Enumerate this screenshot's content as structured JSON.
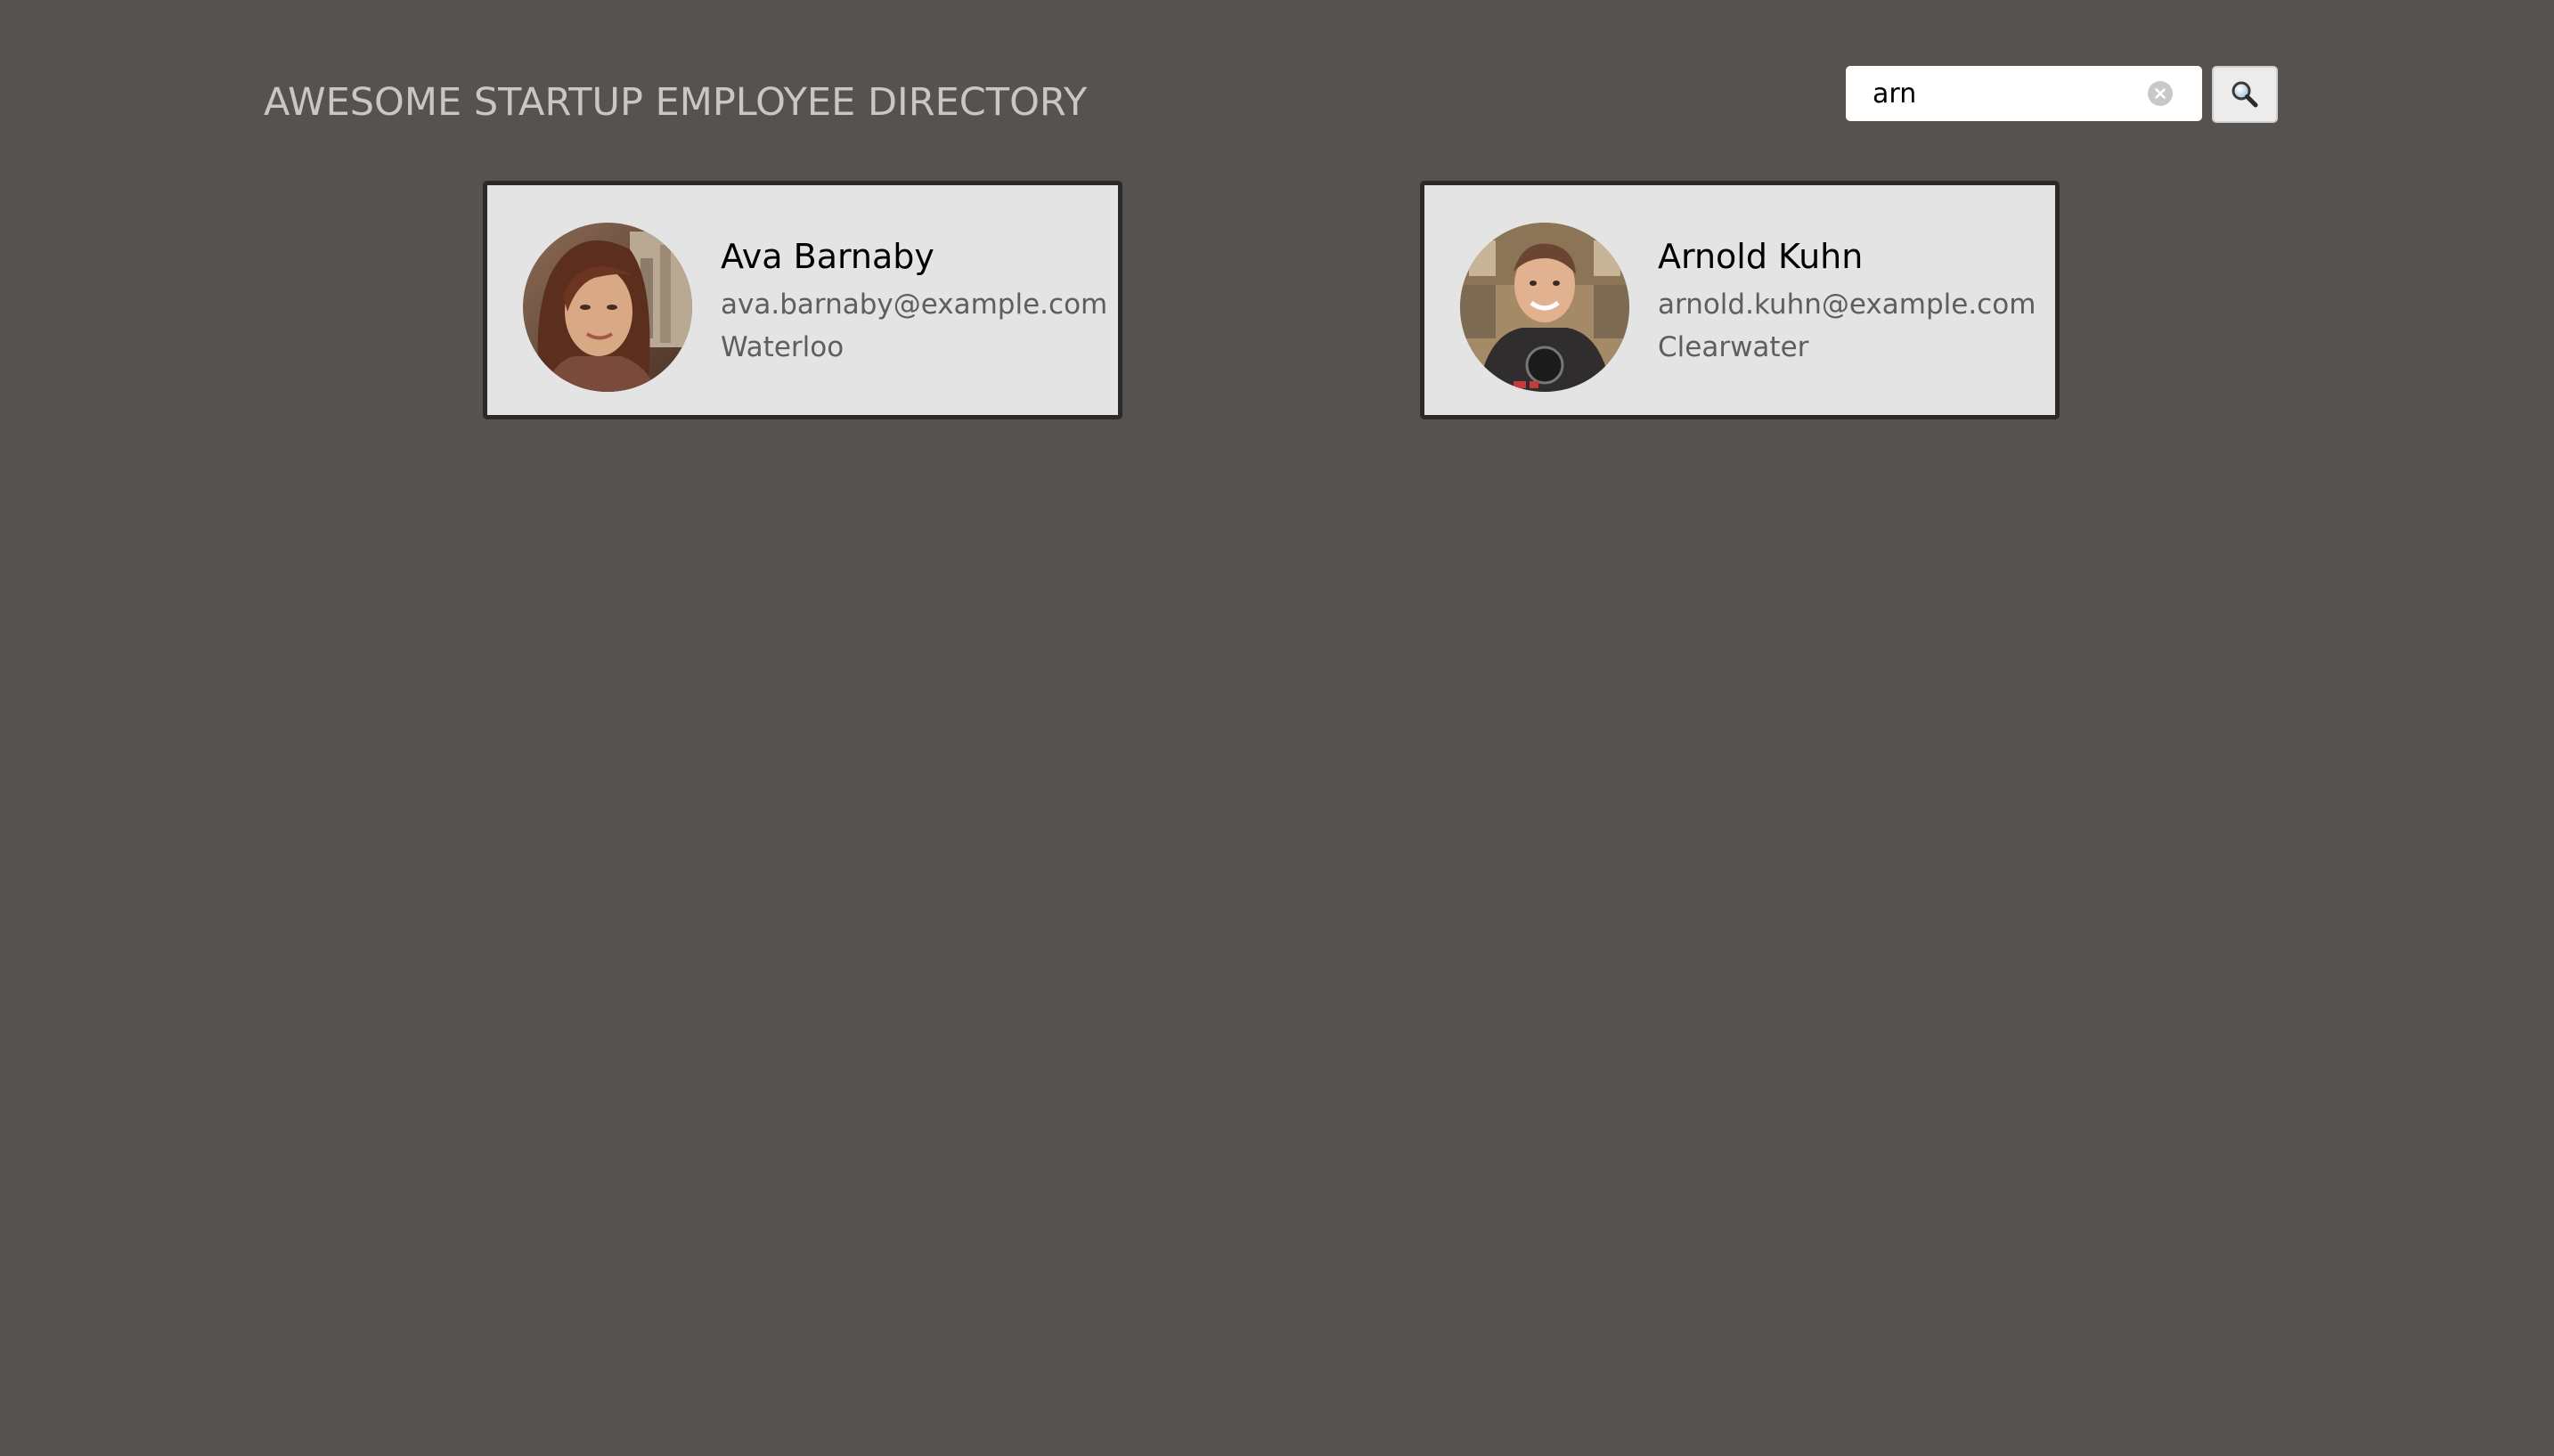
{
  "header": {
    "title": "AWESOME STARTUP EMPLOYEE DIRECTORY"
  },
  "search": {
    "value": "arn",
    "clear_icon": "clear-icon",
    "button_icon": "magnifier-icon"
  },
  "employees": [
    {
      "name": "Ava Barnaby",
      "email": "ava.barnaby@example.com",
      "location": "Waterloo",
      "avatar": "employee-photo"
    },
    {
      "name": "Arnold Kuhn",
      "email": "arnold.kuhn@example.com",
      "location": "Clearwater",
      "avatar": "employee-photo"
    }
  ],
  "colors": {
    "background": "#555250",
    "card_background": "#e5e4e4",
    "card_border": "#2a2a2a",
    "title_text": "#c9c6c3",
    "secondary_text": "#5e5e5e"
  }
}
